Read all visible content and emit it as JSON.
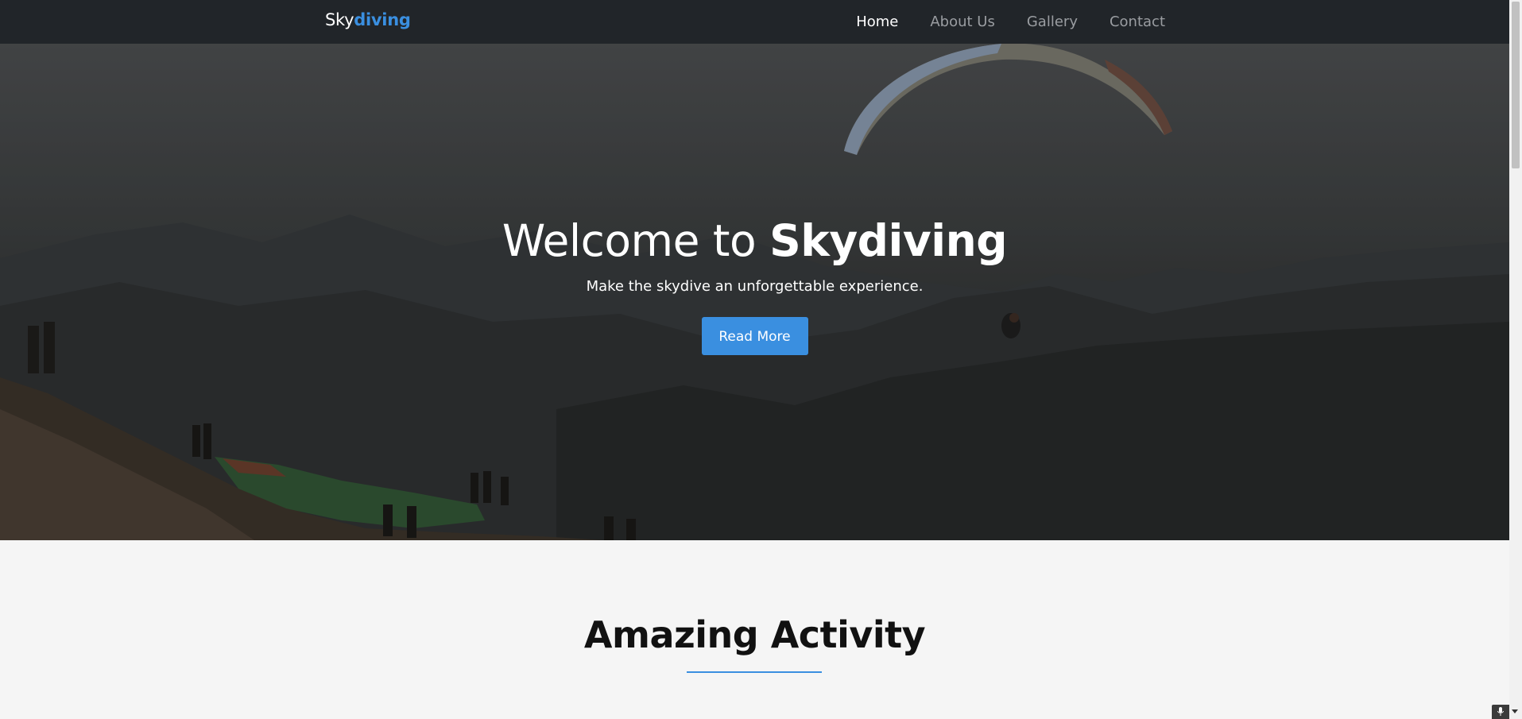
{
  "navbar": {
    "brand_part1": "Sky",
    "brand_part2": "diving",
    "links": [
      "Home",
      "About Us",
      "Gallery",
      "Contact"
    ],
    "active_link": "Home"
  },
  "hero": {
    "title_normal": "Welcome to ",
    "title_bold": "Skydiving",
    "subtitle": "Make the skydive an unforgettable experience.",
    "button_label": "Read More"
  },
  "section": {
    "title": "Amazing Activity"
  },
  "colors": {
    "accent": "#3a8fe0",
    "navbar_bg": "#212529",
    "page_bg": "#f5f5f5"
  },
  "icons": {
    "mic": "microphone-icon"
  }
}
